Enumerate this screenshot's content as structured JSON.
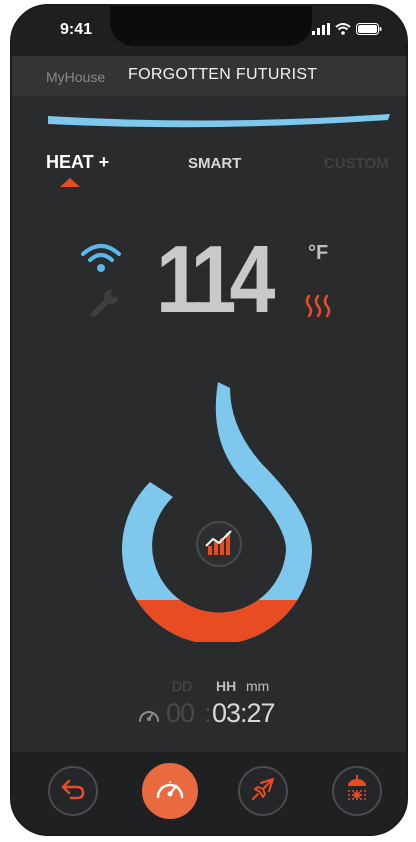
{
  "status_bar": {
    "time": "9:41",
    "signal_icon": "signal-bars-icon",
    "wifi_icon": "wifi-icon",
    "battery_icon": "battery-icon"
  },
  "header": {
    "brand": "MyHouse",
    "title": "FORGOTTEN FUTURIST"
  },
  "tabs": [
    {
      "label": "HEAT +",
      "active": true
    },
    {
      "label": "SMART",
      "active": false
    },
    {
      "label": "CUSTOM",
      "active": false
    }
  ],
  "reading": {
    "value": "114",
    "unit": "°F",
    "wifi_icon": "wifi-icon",
    "wrench_icon": "wrench-icon",
    "heat_icon": "heat-waves-icon"
  },
  "gauge": {
    "center_icon": "bar-chart-icon",
    "colors": {
      "primary": "#7ec8ee",
      "fill": "#e84c22"
    }
  },
  "timer": {
    "labels": {
      "dd": "DD",
      "hh": "HH",
      "mm": "mm"
    },
    "dd": "00",
    "separator": ":",
    "hhmm": "03:27",
    "icon": "speedometer-icon"
  },
  "bottom_nav": [
    {
      "name": "back",
      "icon": "back-arrow-icon"
    },
    {
      "name": "speed",
      "icon": "speedometer-icon",
      "active": true
    },
    {
      "name": "flight",
      "icon": "airplane-icon"
    },
    {
      "name": "shower",
      "icon": "shower-snowflake-icon"
    }
  ],
  "colors": {
    "accent": "#e84c22",
    "blue": "#7ec8ee",
    "background": "#2a2b2d"
  }
}
